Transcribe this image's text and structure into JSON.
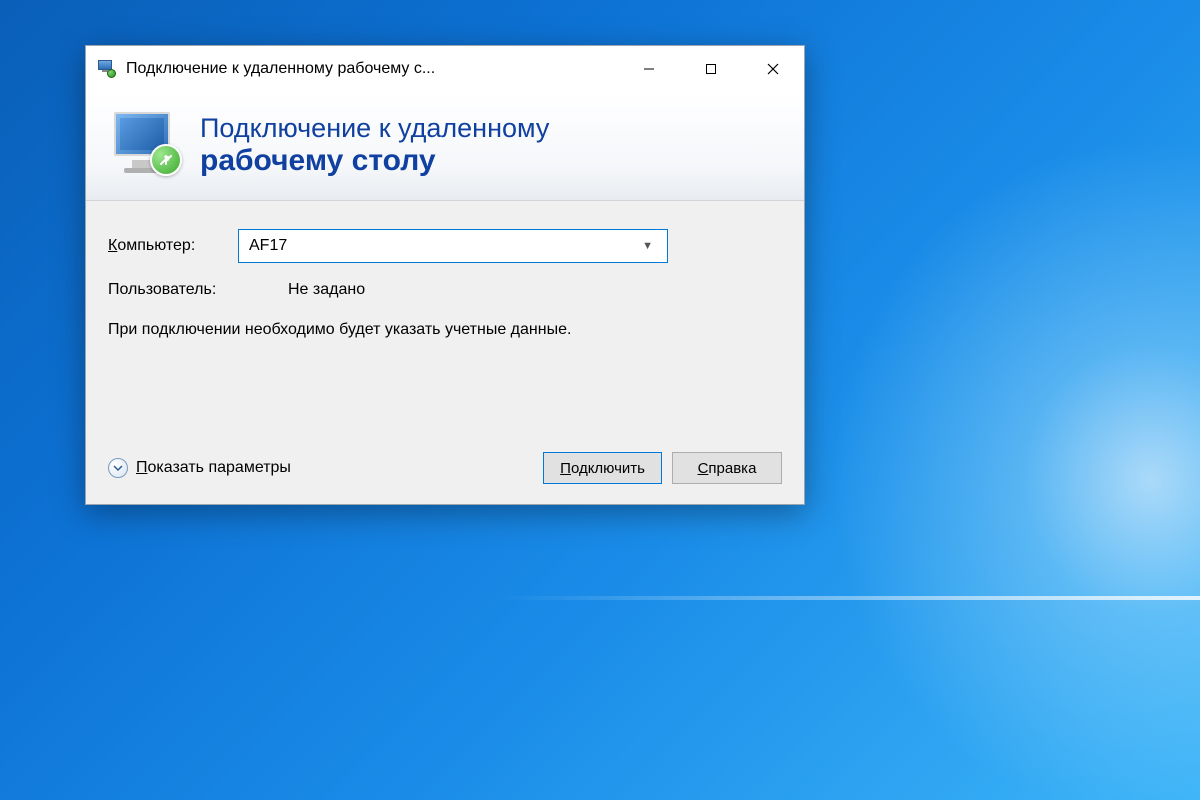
{
  "window": {
    "title": "Подключение к удаленному рабочему с..."
  },
  "header": {
    "line1": "Подключение к удаленному",
    "line2": "рабочему столу"
  },
  "form": {
    "computer_label": "Компьютер:",
    "computer_label_u": "К",
    "computer_label_rest": "омпьютер:",
    "computer_value": "AF17",
    "user_label": "Пользователь:",
    "user_value": "Не задано",
    "info": "При подключении необходимо будет указать учетные данные."
  },
  "footer": {
    "show_options_u": "П",
    "show_options_rest": "оказать параметры",
    "connect_label": "Подключить",
    "connect_u": "П",
    "connect_rest": "одключить",
    "help_u": "С",
    "help_rest": "правка"
  }
}
